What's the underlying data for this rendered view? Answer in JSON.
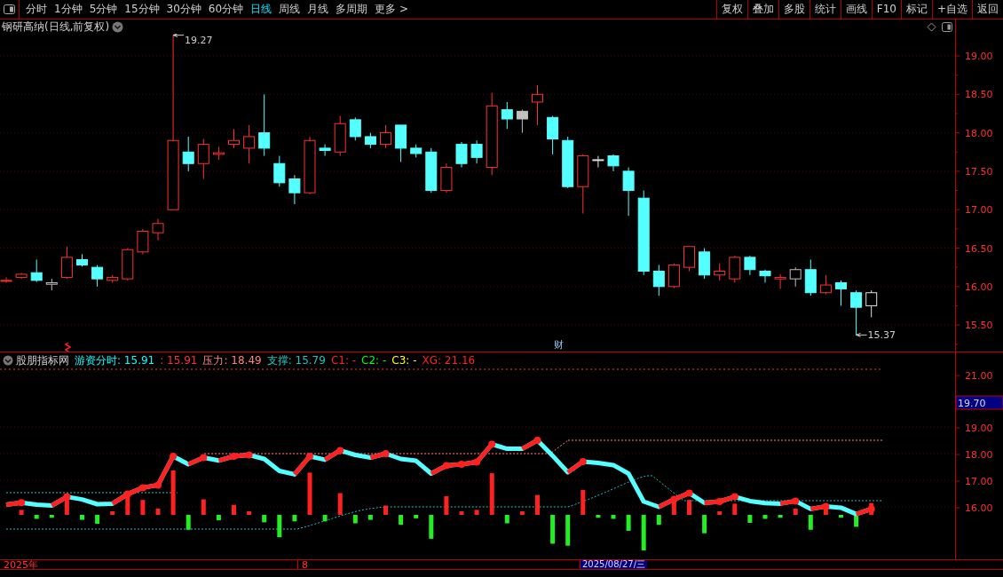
{
  "toolbar": {
    "periods": [
      {
        "label": "分时",
        "selected": false
      },
      {
        "label": "1分钟",
        "selected": false
      },
      {
        "label": "5分钟",
        "selected": false
      },
      {
        "label": "15分钟",
        "selected": false
      },
      {
        "label": "30分钟",
        "selected": false
      },
      {
        "label": "60分钟",
        "selected": false
      },
      {
        "label": "日线",
        "selected": true
      },
      {
        "label": "周线",
        "selected": false
      },
      {
        "label": "月线",
        "selected": false
      },
      {
        "label": "多周期",
        "selected": false
      },
      {
        "label": "更多 >",
        "selected": false
      }
    ],
    "buttons": [
      "复权",
      "叠加",
      "多股",
      "统计",
      "画线",
      "F10",
      "标记",
      "+自选",
      "返回"
    ]
  },
  "price_chart": {
    "title": "钢研高纳(日线,前复权)",
    "high_label": "19.27",
    "low_label": "15.37",
    "event_marker": "财",
    "y_ticks": [
      "19.00",
      "18.50",
      "18.00",
      "17.50",
      "17.00",
      "16.50",
      "16.00",
      "15.50"
    ]
  },
  "indicator": {
    "name": "股朋指标网",
    "values": [
      {
        "text": "游资分时: 15.91",
        "color": "#00ffff"
      },
      {
        "text": ": 15.91",
        "color": "#ff3030"
      },
      {
        "text": "压力: 18.49",
        "color": "#ff8080"
      },
      {
        "text": "支撑: 15.79",
        "color": "#20c0c0"
      },
      {
        "text": "C1: -",
        "color": "#ff2020"
      },
      {
        "text": "C2: -",
        "color": "#00ff00"
      },
      {
        "text": "C3: -",
        "color": "#ffff00"
      },
      {
        "text": "XG: 21.16",
        "color": "#ff2020"
      }
    ],
    "y_ticks": [
      "21.00",
      "19.00",
      "18.00",
      "17.00",
      "16.00"
    ],
    "current_value": "19.70"
  },
  "date_axis": {
    "labels": [
      "2025年",
      "8"
    ],
    "cursor_date": "2025/08/27/三"
  }
}
